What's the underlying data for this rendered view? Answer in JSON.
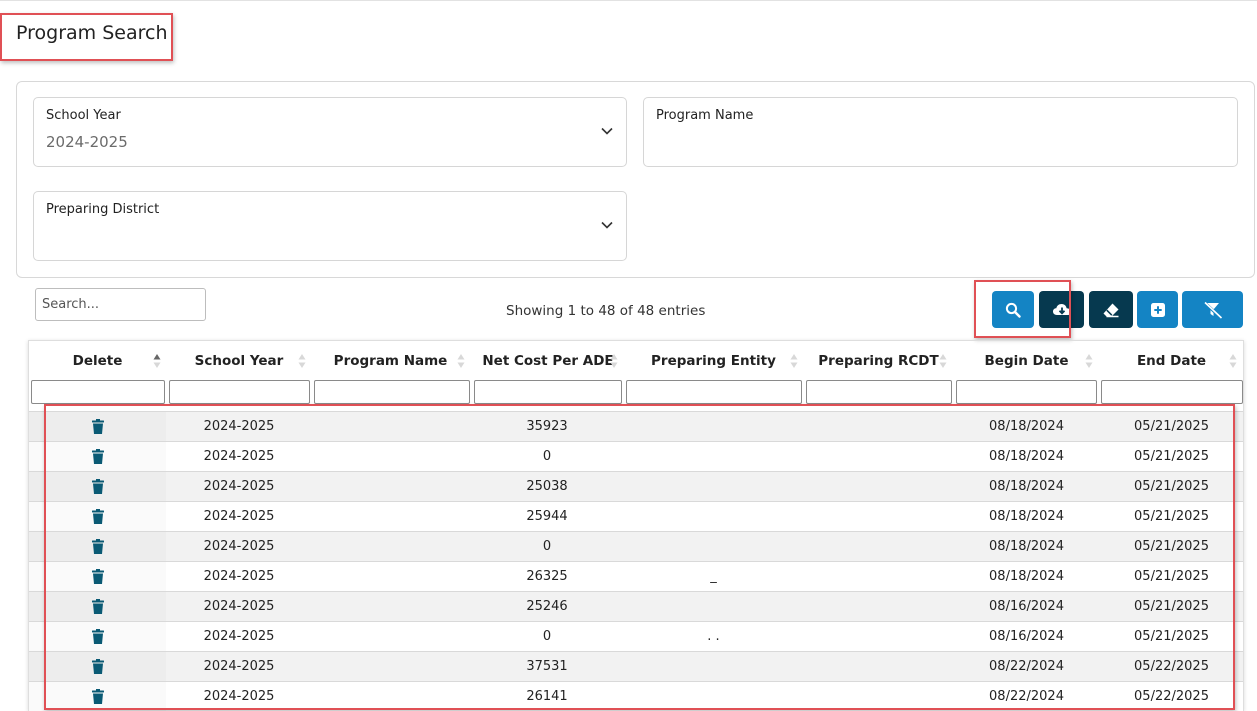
{
  "page": {
    "title": "Program Search"
  },
  "filters": {
    "school_year": {
      "label": "School Year",
      "value": "2024-2025"
    },
    "program_name": {
      "label": "Program Name",
      "value": ""
    },
    "preparing_district": {
      "label": "Preparing District",
      "value": ""
    }
  },
  "search": {
    "placeholder": "Search..."
  },
  "entries_info": "Showing 1 to 48 of 48 entries",
  "toolbar": {
    "search_icon": "magnifier-icon",
    "export_icon": "cloud-download-icon",
    "clear_icon": "eraser-icon",
    "add_icon": "plus-square-icon",
    "filter_icon": "filter-clear-icon"
  },
  "table": {
    "columns": [
      "Delete",
      "School Year",
      "Program Name",
      "Net Cost Per ADE",
      "Preparing Entity",
      "Preparing RCDT",
      "Begin Date",
      "End Date"
    ],
    "rows": [
      {
        "school_year": "2024-2025",
        "program_name": "",
        "net_cost": "35923",
        "entity": "",
        "rcdt": "",
        "begin": "08/18/2024",
        "end": "05/21/2025"
      },
      {
        "school_year": "2024-2025",
        "program_name": "",
        "net_cost": "0",
        "entity": "",
        "rcdt": "",
        "begin": "08/18/2024",
        "end": "05/21/2025"
      },
      {
        "school_year": "2024-2025",
        "program_name": "",
        "net_cost": "25038",
        "entity": "",
        "rcdt": "",
        "begin": "08/18/2024",
        "end": "05/21/2025"
      },
      {
        "school_year": "2024-2025",
        "program_name": "",
        "net_cost": "25944",
        "entity": "",
        "rcdt": "",
        "begin": "08/18/2024",
        "end": "05/21/2025"
      },
      {
        "school_year": "2024-2025",
        "program_name": "",
        "net_cost": "0",
        "entity": "",
        "rcdt": "",
        "begin": "08/18/2024",
        "end": "05/21/2025"
      },
      {
        "school_year": "2024-2025",
        "program_name": "",
        "net_cost": "26325",
        "entity": "_",
        "rcdt": "",
        "begin": "08/18/2024",
        "end": "05/21/2025"
      },
      {
        "school_year": "2024-2025",
        "program_name": "",
        "net_cost": "25246",
        "entity": "",
        "rcdt": "",
        "begin": "08/16/2024",
        "end": "05/21/2025"
      },
      {
        "school_year": "2024-2025",
        "program_name": "",
        "net_cost": "0",
        "entity": ". .",
        "rcdt": "",
        "begin": "08/16/2024",
        "end": "05/21/2025"
      },
      {
        "school_year": "2024-2025",
        "program_name": "",
        "net_cost": "37531",
        "entity": "",
        "rcdt": "",
        "begin": "08/22/2024",
        "end": "05/22/2025"
      },
      {
        "school_year": "2024-2025",
        "program_name": "",
        "net_cost": "26141",
        "entity": "",
        "rcdt": "",
        "begin": "08/22/2024",
        "end": "05/22/2025"
      }
    ]
  },
  "colors": {
    "primary": "#1484c4",
    "dark": "#06394f",
    "highlight": "#e05055",
    "icon": "#0a5a74"
  }
}
